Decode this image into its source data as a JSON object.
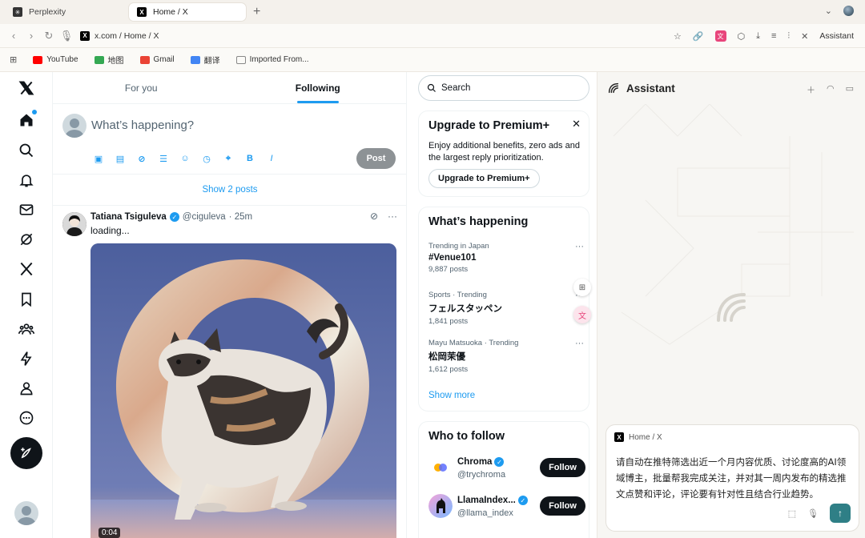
{
  "browser": {
    "tabs": [
      {
        "title": "Perplexity",
        "active": false
      },
      {
        "title": "Home / X",
        "active": true
      }
    ],
    "new_tab": "+",
    "url": "x.com / Home / X",
    "assistant_button": "Assistant",
    "bookmarks": [
      {
        "label": "YouTube",
        "color": "#ff0000"
      },
      {
        "label": "地图",
        "color": "#34a853"
      },
      {
        "label": "Gmail",
        "color": "#ea4335"
      },
      {
        "label": "翻译",
        "color": "#4285f4"
      },
      {
        "label": "Imported From...",
        "color": "#888888"
      }
    ]
  },
  "feed": {
    "tabs": [
      "For you",
      "Following"
    ],
    "active_tab": "Following",
    "compose_placeholder": "What’s happening?",
    "post_button": "Post",
    "compose_bold": "B",
    "compose_italic": "I",
    "show_posts": "Show 2 posts",
    "tweet": {
      "name": "Tatiana Tsiguleva",
      "handle": "@ciguleva",
      "time": "· 25m",
      "text": "loading...",
      "video_time": "0:04"
    }
  },
  "right": {
    "search_placeholder": "Search",
    "premium": {
      "title": "Upgrade to Premium+",
      "body": "Enjoy additional benefits, zero ads and the largest reply prioritization.",
      "button": "Upgrade to Premium+"
    },
    "trends": {
      "title": "What’s happening",
      "items": [
        {
          "meta": "Trending in Japan",
          "name": "#Venue101",
          "count": "9,887 posts"
        },
        {
          "meta": "Sports · Trending",
          "name": "フェルスタッペン",
          "count": "1,841 posts"
        },
        {
          "meta": "Mayu Matsuoka · Trending",
          "name": "松岡茉優",
          "count": "1,612 posts"
        }
      ],
      "show_more": "Show more"
    },
    "who_to_follow": {
      "title": "Who to follow",
      "items": [
        {
          "name": "Chroma",
          "handle": "@trychroma",
          "button": "Follow"
        },
        {
          "name": "LlamaIndex...",
          "handle": "@llama_index",
          "button": "Follow"
        }
      ]
    }
  },
  "assistant": {
    "title": "Assistant",
    "context": "Home / X",
    "prompt": "请自动在推特筛选出近一个月内容优质、讨论度高的AI领域博主，批量帮我完成关注，并对其一周内发布的精选推文点赞和评论，评论要有针对性且结合行业趋势。"
  },
  "colors": {
    "accent": "#1d9bf0",
    "send": "#2f7f86",
    "translate": "#e8457b"
  }
}
